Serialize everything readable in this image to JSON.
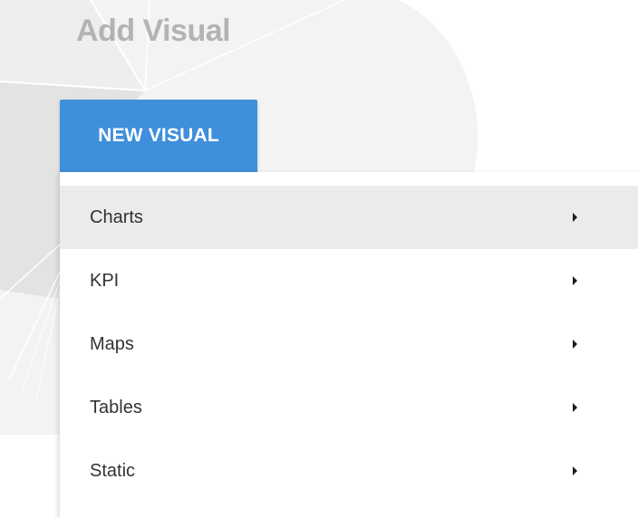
{
  "header": {
    "title": "Add Visual"
  },
  "toolbar": {
    "new_visual_label": "NEW VISUAL"
  },
  "menu": {
    "items": [
      {
        "label": "Charts",
        "icon": "chevron-right-icon",
        "active": true
      },
      {
        "label": "KPI",
        "icon": "chevron-right-icon",
        "active": false
      },
      {
        "label": "Maps",
        "icon": "chevron-right-icon",
        "active": false
      },
      {
        "label": "Tables",
        "icon": "chevron-right-icon",
        "active": false
      },
      {
        "label": "Static",
        "icon": "chevron-right-icon",
        "active": false
      }
    ]
  },
  "colors": {
    "accent": "#3f8fdb",
    "active_item_bg": "#ebebeb",
    "text": "#333333",
    "header_text": "#b3b3b3"
  }
}
